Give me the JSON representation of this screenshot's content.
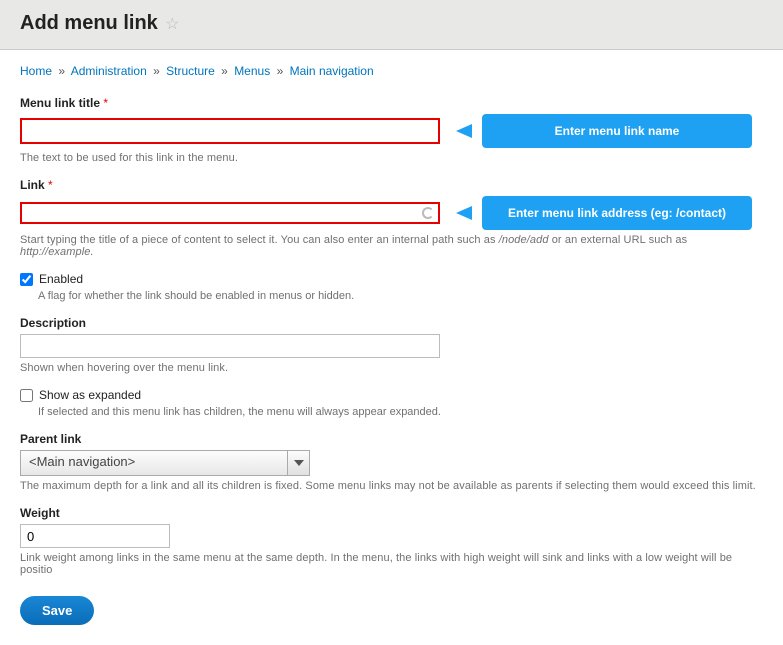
{
  "header": {
    "title": "Add menu link"
  },
  "breadcrumbs": {
    "items": [
      "Home",
      "Administration",
      "Structure",
      "Menus",
      "Main navigation"
    ],
    "sep": "»"
  },
  "form": {
    "title": {
      "label": "Menu link title",
      "value": "",
      "help": "The text to be used for this link in the menu.",
      "callout": "Enter menu link name"
    },
    "link": {
      "label": "Link",
      "value": "",
      "help_pre": "Start typing the title of a piece of content to select it. You can also enter an internal path such as ",
      "help_em1": "/node/add",
      "help_mid": " or an external URL such as ",
      "help_em2": "http://example.",
      "callout": "Enter menu link address (eg: /contact)"
    },
    "enabled": {
      "label": "Enabled",
      "checked": true,
      "help": "A flag for whether the link should be enabled in menus or hidden."
    },
    "description": {
      "label": "Description",
      "value": "",
      "help": "Shown when hovering over the menu link."
    },
    "expanded": {
      "label": "Show as expanded",
      "checked": false,
      "help": "If selected and this menu link has children, the menu will always appear expanded."
    },
    "parent": {
      "label": "Parent link",
      "selected": "<Main navigation>",
      "help": "The maximum depth for a link and all its children is fixed. Some menu links may not be available as parents if selecting them would exceed this limit."
    },
    "weight": {
      "label": "Weight",
      "value": "0",
      "help": "Link weight among links in the same menu at the same depth. In the menu, the links with high weight will sink and links with a low weight will be positio"
    },
    "submit": {
      "label": "Save"
    }
  }
}
